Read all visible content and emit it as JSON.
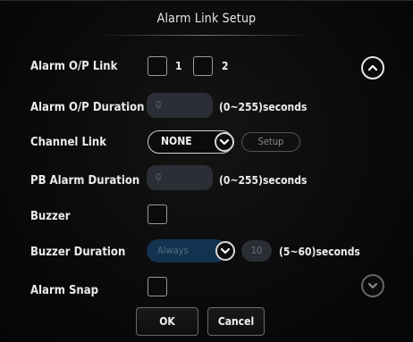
{
  "dialog": {
    "title": "Alarm Link Setup"
  },
  "rows": {
    "alarm_op_link": {
      "label": "Alarm O/P Link",
      "option1": "1",
      "option2": "2"
    },
    "alarm_op_duration": {
      "label": "Alarm O/P Duration",
      "value": "0",
      "unit": "(0~255)seconds"
    },
    "channel_link": {
      "label": "Channel Link",
      "value": "NONE",
      "setup_label": "Setup"
    },
    "pb_alarm_duration": {
      "label": "PB Alarm Duration",
      "value": "0",
      "unit": "(0~255)seconds"
    },
    "buzzer": {
      "label": "Buzzer"
    },
    "buzzer_duration": {
      "label": "Buzzer Duration",
      "mode": "Always",
      "value": "10",
      "unit": "(5~60)seconds"
    },
    "alarm_snap": {
      "label": "Alarm Snap"
    }
  },
  "buttons": {
    "ok": "OK",
    "cancel": "Cancel"
  },
  "icons": {
    "scroll_up": "chevron-up-icon",
    "scroll_down": "chevron-down-icon",
    "dropdown": "chevron-down-icon"
  },
  "colors": {
    "background": "#0a0a0a",
    "field": "#2b2f35",
    "selected_blue": "#12324f"
  }
}
